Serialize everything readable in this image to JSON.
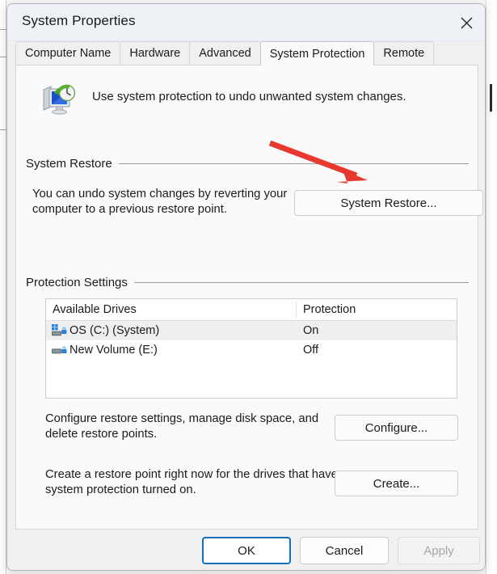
{
  "window": {
    "title": "System Properties",
    "close_icon": "close-icon"
  },
  "tabs": [
    {
      "label": "Computer Name",
      "selected": false
    },
    {
      "label": "Hardware",
      "selected": false
    },
    {
      "label": "Advanced",
      "selected": false
    },
    {
      "label": "System Protection",
      "selected": true
    },
    {
      "label": "Remote",
      "selected": false
    }
  ],
  "header": {
    "icon": "system-restore-icon",
    "text": "Use system protection to undo unwanted system changes."
  },
  "system_restore": {
    "group_label": "System Restore",
    "description": "You can undo system changes by reverting your computer to a previous restore point.",
    "button_label": "System Restore..."
  },
  "protection_settings": {
    "group_label": "Protection Settings",
    "columns": [
      "Available Drives",
      "Protection"
    ],
    "rows": [
      {
        "icon": "windows-drive-icon",
        "name": "OS (C:) (System)",
        "protection": "On",
        "selected": true
      },
      {
        "icon": "drive-icon",
        "name": "New Volume (E:)",
        "protection": "Off",
        "selected": false
      }
    ],
    "configure": {
      "description": "Configure restore settings, manage disk space, and delete restore points.",
      "button_label": "Configure..."
    },
    "create": {
      "description": "Create a restore point right now for the drives that have system protection turned on.",
      "button_label": "Create..."
    }
  },
  "footer": {
    "ok_label": "OK",
    "cancel_label": "Cancel",
    "apply_label": "Apply"
  },
  "annotation": {
    "type": "arrow",
    "color": "#e8392f",
    "points_to": "System Restore..."
  }
}
